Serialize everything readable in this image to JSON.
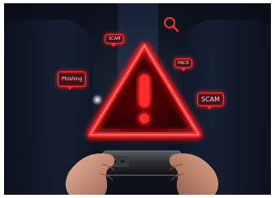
{
  "image": {
    "subject": "hands holding smartphone with red warning triangle and scam alert bubbles",
    "colors": {
      "background": "#0b101a",
      "alert_red": "#ff2a2a",
      "skin": "#c98f74"
    }
  },
  "labels": {
    "scam_top": "SCAM",
    "hack": "HACK",
    "phishing": "Phishing",
    "scam_right": "SCAM"
  },
  "icons": {
    "warning": "warning-triangle-icon",
    "search": "search-icon",
    "phone": "smartphone"
  }
}
